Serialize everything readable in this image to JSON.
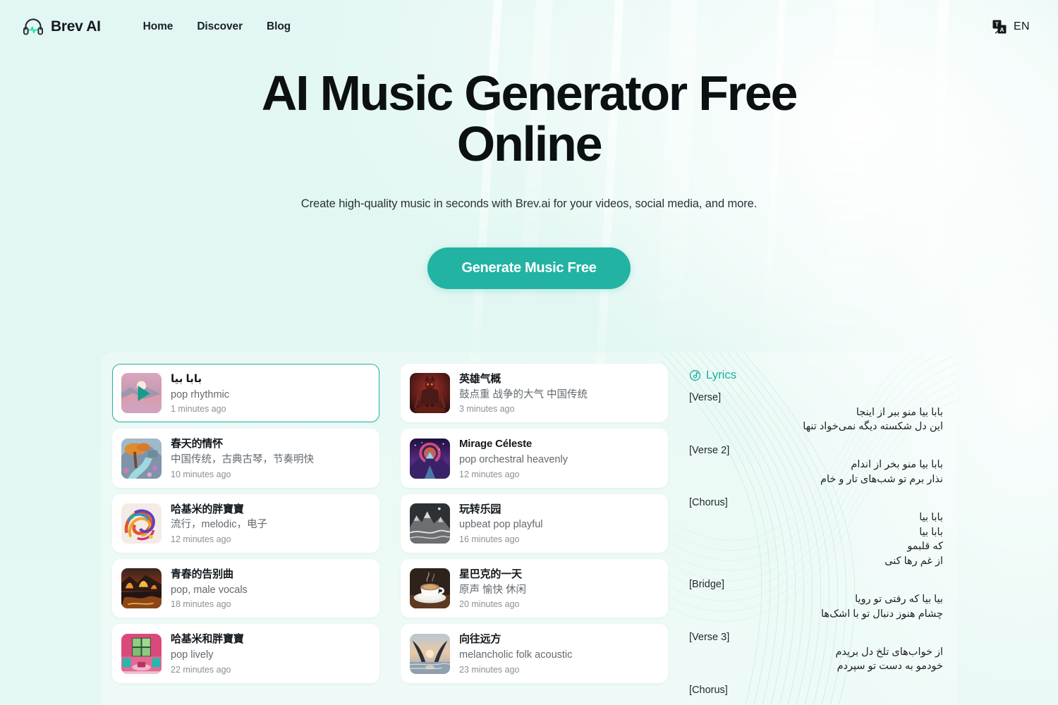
{
  "header": {
    "brand": "Brev AI",
    "logo_icon": "headphones-waveform-icon",
    "nav": [
      {
        "label": "Home"
      },
      {
        "label": "Discover"
      },
      {
        "label": "Blog"
      }
    ],
    "language_icon": "translate-icon",
    "language": "EN"
  },
  "hero": {
    "title": "AI Music Generator Free Online",
    "subtitle": "Create high-quality music in seconds with Brev.ai for your videos, social media, and more.",
    "cta": "Generate Music Free"
  },
  "colors": {
    "accent": "#22b3a3",
    "background": "#e2f7f3",
    "card_background": "#ffffff",
    "title_text": "#13181c",
    "muted_text": "#62696f"
  },
  "tracks_column_1": [
    {
      "title": "بابا بیا",
      "style": "pop rhythmic",
      "time": "1 minutes ago",
      "selected": true,
      "playing": true,
      "thumb": "sunset-mountains"
    },
    {
      "title": "春天的情怀",
      "style": "中国传统，古典古琴，节奏明快",
      "time": "10 minutes ago",
      "selected": false,
      "playing": false,
      "thumb": "spring-tree-river"
    },
    {
      "title": "哈基米的胖寶寶",
      "style": "流行，melodic，电子",
      "time": "12 minutes ago",
      "selected": false,
      "playing": false,
      "thumb": "colorful-swirls"
    },
    {
      "title": "青春的告别曲",
      "style": "pop, male vocals",
      "time": "18 minutes ago",
      "selected": false,
      "playing": false,
      "thumb": "fiery-landscape"
    },
    {
      "title": "哈基米和胖寶寶",
      "style": "pop lively",
      "time": "22 minutes ago",
      "selected": false,
      "playing": false,
      "thumb": "pink-interior-room"
    }
  ],
  "tracks_column_2": [
    {
      "title": "英雄气概",
      "style": "鼓点重 战争的大气 中国传统",
      "time": "3 minutes ago",
      "selected": false,
      "playing": false,
      "thumb": "red-warrior"
    },
    {
      "title": "Mirage Céleste",
      "style": "pop orchestral heavenly",
      "time": "12 minutes ago",
      "selected": false,
      "playing": false,
      "thumb": "purple-cosmic-mountain"
    },
    {
      "title": "玩转乐园",
      "style": "upbeat pop playful",
      "time": "16 minutes ago",
      "selected": false,
      "playing": false,
      "thumb": "grey-mountains"
    },
    {
      "title": "星巴克的一天",
      "style": "原声 愉快 休闲",
      "time": "20 minutes ago",
      "selected": false,
      "playing": false,
      "thumb": "coffee-cup"
    },
    {
      "title": "向往远方",
      "style": "melancholic folk acoustic",
      "time": "23 minutes ago",
      "selected": false,
      "playing": false,
      "thumb": "sunset-beach-wings"
    }
  ],
  "lyrics": {
    "icon": "vinyl-disc-icon",
    "heading": "Lyrics",
    "sections": [
      {
        "tag": "[Verse]",
        "lines": [
          "بابا بیا منو ببر از اینجا",
          "این دل شکسته دیگه نمی‌خواد تنها"
        ]
      },
      {
        "tag": "[Verse 2]",
        "lines": [
          "بابا بیا منو بخر از اندام",
          "نذار برم تو شب‌های تار و خام"
        ]
      },
      {
        "tag": "[Chorus]",
        "lines": [
          "بابا بیا",
          "بابا بیا",
          "که قلبمو",
          "از غم رها کنی"
        ]
      },
      {
        "tag": "[Bridge]",
        "lines": [
          "بیا بیا که رفتی تو رویا",
          "چشام هنوز دنبال تو با اشک‌ها"
        ]
      },
      {
        "tag": "[Verse 3]",
        "lines": [
          "از خواب‌های تلخ دل بریدم",
          "خودمو به دست تو سپردم"
        ]
      },
      {
        "tag": "[Chorus]",
        "lines": []
      }
    ]
  }
}
